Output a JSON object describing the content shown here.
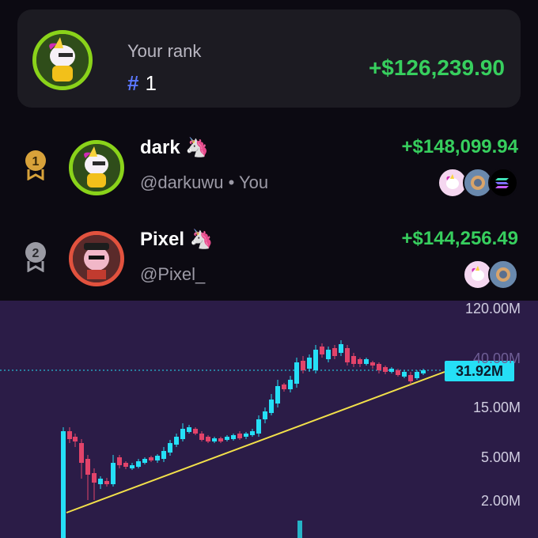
{
  "rank_card": {
    "label": "Your rank",
    "hash": "#",
    "rank": "1",
    "profit": "+$126,239.90",
    "avatar_icon": "unicorn-avatar-icon"
  },
  "leaderboard": [
    {
      "position": "1",
      "name": "dark",
      "emoji": "🦄",
      "handle": "@darkuwu • You",
      "profit": "+$148,099.94",
      "medal_color": "#d8a23a",
      "tokens": [
        "unicorn-token-icon",
        "coin-token-icon",
        "solana-token-icon"
      ]
    },
    {
      "position": "2",
      "name": "Pixel",
      "emoji": "🦄",
      "handle": "@Pixel_",
      "profit": "+$144,256.49",
      "medal_color": "#9a9aa3",
      "tokens": [
        "unicorn-token-icon",
        "coin-token-icon"
      ]
    }
  ],
  "chart": {
    "price_tag": "31.92M",
    "y_ticks": [
      "120.00M",
      "40.00M",
      "15.00M",
      "5.00M",
      "2.00M"
    ],
    "accent_up": "#25dff6",
    "accent_down": "#e2436a",
    "trend_color": "#f2e04a"
  },
  "chart_data": {
    "type": "candlestick",
    "y_scale": "log",
    "ylabels": [
      "120.00M",
      "40.00M",
      "15.00M",
      "5.00M",
      "2.00M"
    ],
    "last_price": "31.92M",
    "trendline": {
      "from": "low start",
      "to": "last price"
    }
  }
}
